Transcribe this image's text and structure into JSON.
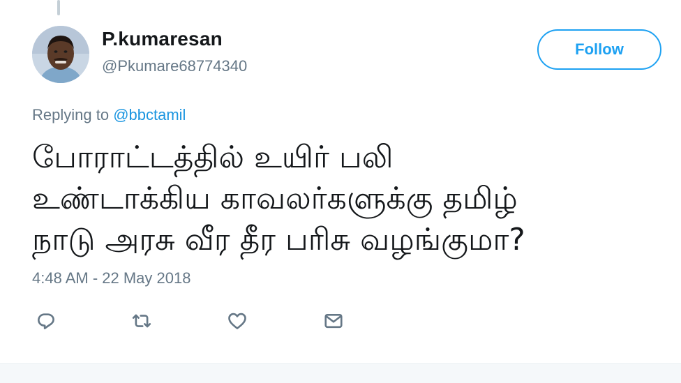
{
  "tweet": {
    "author": {
      "display_name": "P.kumaresan",
      "handle": "@Pkumare68774340",
      "avatar": "user-avatar-photo"
    },
    "follow_label": "Follow",
    "replying_prefix": "Replying to ",
    "replying_to": "@bbctamil",
    "text": "போராட்டத்தில் உயிர் பலி\nஉண்டாக்கிய  காவலர்களுக்கு தமிழ்\nநாடு அரசு வீர தீர பரிசு வழங்குமா?",
    "timestamp": "4:48 AM - 22 May 2018",
    "actions": [
      {
        "name": "reply",
        "icon": "reply-icon"
      },
      {
        "name": "retweet",
        "icon": "retweet-icon"
      },
      {
        "name": "like",
        "icon": "heart-icon"
      },
      {
        "name": "direct-message",
        "icon": "envelope-icon"
      }
    ]
  },
  "colors": {
    "accent": "#1da1f2",
    "text": "#14171a",
    "secondary_text": "#657786",
    "mention": "#1b95e0"
  }
}
